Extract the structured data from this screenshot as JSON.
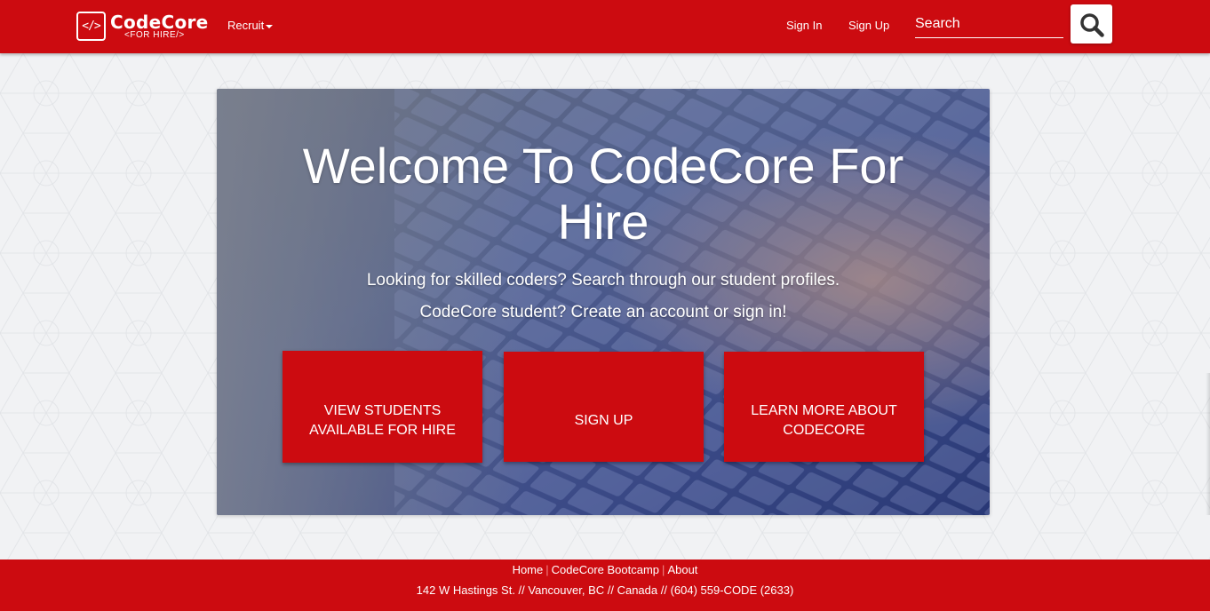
{
  "brand": {
    "logo_glyph": "</>",
    "name": "CodeCore",
    "tagline": "<FOR HIRE/>"
  },
  "nav": {
    "recruit_label": "Recruit",
    "sign_in": "Sign In",
    "sign_up": "Sign Up",
    "search_placeholder": "Search",
    "search_icon": "search-icon"
  },
  "hero": {
    "title": "Welcome To CodeCore For Hire",
    "line1": "Looking for skilled coders? Search through our student profiles.",
    "line2": "CodeCore student? Create an account or sign in!",
    "buttons": [
      {
        "label": "VIEW STUDENTS AVAILABLE FOR HIRE"
      },
      {
        "label": "SIGN UP"
      },
      {
        "label": "LEARN MORE ABOUT CODECORE"
      }
    ]
  },
  "footer": {
    "links": [
      "Home",
      "CodeCore Bootcamp",
      "About"
    ],
    "separator": "|",
    "address": "142 W Hastings St. // Vancouver, BC // Canada // (604) 559-CODE (2633)"
  },
  "colors": {
    "brand_red": "#cc0b10",
    "page_background": "#f1f2f4",
    "text_on_brand": "#ffffff"
  }
}
